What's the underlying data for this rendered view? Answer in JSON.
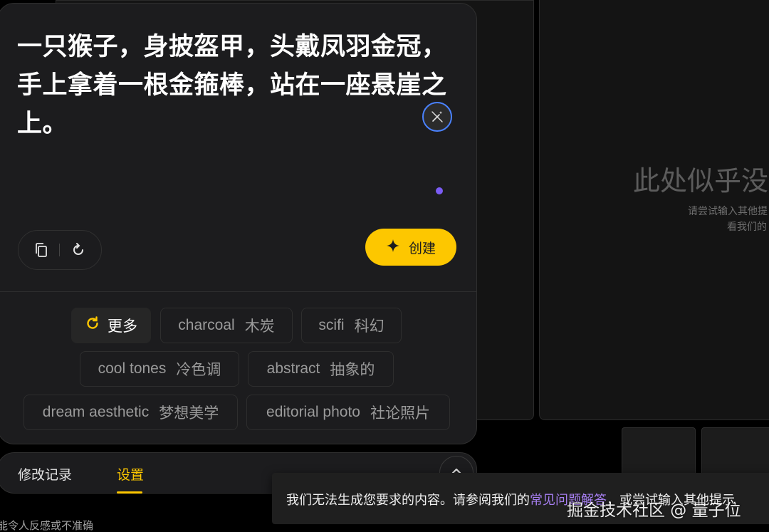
{
  "prompt": {
    "text": "一只猴子，身披盔甲，头戴凤羽金冠，手上拿着一根金箍棒，站在一座悬崖之上。"
  },
  "icons": {
    "magic": "wand-icon",
    "copy": "copy-icon",
    "refresh": "refresh-icon",
    "sparkle": "sparkle-icon",
    "more": "refresh-icon",
    "collapse": "chevron-up-icon"
  },
  "create_button": {
    "label": "创建"
  },
  "chips": [
    {
      "label": "更多",
      "zh": ""
    },
    {
      "label": "charcoal",
      "zh": "木炭"
    },
    {
      "label": "scifi",
      "zh": "科幻"
    },
    {
      "label": "cool tones",
      "zh": "冷色调"
    },
    {
      "label": "abstract",
      "zh": "抽象的"
    },
    {
      "label": "dream aesthetic",
      "zh": "梦想美学"
    },
    {
      "label": "editorial photo",
      "zh": "社论照片"
    }
  ],
  "tabs": [
    {
      "label": "修改记录",
      "active": false
    },
    {
      "label": "设置",
      "active": true
    }
  ],
  "empty_state": {
    "title": "此处似乎没有",
    "line1": "请尝试输入其他提",
    "line2": "看我们的"
  },
  "footer": {
    "text": "能令人反感或不准确"
  },
  "toast": {
    "text_before": "我们无法生成您要求的内容。请参阅我们的",
    "link": "常见问题解答",
    "text_after": "，或尝试输入其他提示"
  },
  "watermark": {
    "text": "掘金技术社区 @ 量子位"
  },
  "colors": {
    "accent": "#fdc700",
    "link": "#a77ff2",
    "focus_ring": "#4a82ff",
    "indicator": "#7b5cf5"
  }
}
